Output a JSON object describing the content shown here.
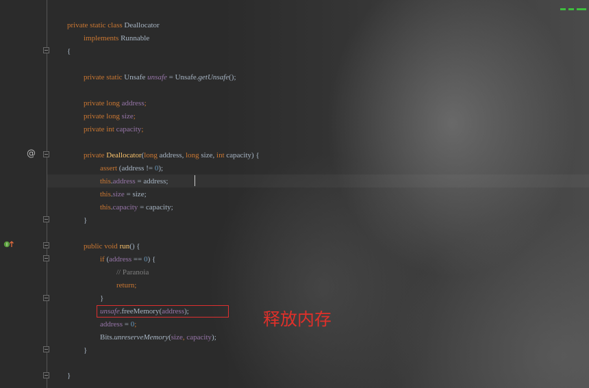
{
  "editor": {
    "lines": [
      {
        "id": "l1",
        "tokens": [
          {
            "t": "private static class ",
            "c": "kw"
          },
          {
            "t": "Deallocator",
            "c": "plain"
          }
        ]
      },
      {
        "id": "l2",
        "tokens": [
          {
            "t": "implements ",
            "c": "kw"
          },
          {
            "t": "Runnable",
            "c": "plain"
          }
        ]
      },
      {
        "id": "l3",
        "tokens": [
          {
            "t": "{",
            "c": "plain"
          }
        ]
      },
      {
        "id": "l4",
        "tokens": [
          {
            "t": "private static ",
            "c": "kw"
          },
          {
            "t": "Unsafe ",
            "c": "plain"
          },
          {
            "t": "unsafe",
            "c": "static-field"
          },
          {
            "t": " = Unsafe.",
            "c": "plain"
          },
          {
            "t": "getUnsafe",
            "c": "static-call"
          },
          {
            "t": "();",
            "c": "plain"
          }
        ]
      },
      {
        "id": "l5",
        "tokens": [
          {
            "t": "private long ",
            "c": "kw"
          },
          {
            "t": "address",
            "c": "field"
          },
          {
            "t": ";",
            "c": "kw"
          }
        ]
      },
      {
        "id": "l6",
        "tokens": [
          {
            "t": "private long ",
            "c": "kw"
          },
          {
            "t": "size",
            "c": "field"
          },
          {
            "t": ";",
            "c": "kw"
          }
        ]
      },
      {
        "id": "l7",
        "tokens": [
          {
            "t": "private int ",
            "c": "kw"
          },
          {
            "t": "capacity",
            "c": "field"
          },
          {
            "t": ";",
            "c": "kw"
          }
        ]
      },
      {
        "id": "l8",
        "tokens": [
          {
            "t": "private ",
            "c": "kw"
          },
          {
            "t": "Deallocator",
            "c": "method-decl"
          },
          {
            "t": "(",
            "c": "plain"
          },
          {
            "t": "long ",
            "c": "kw"
          },
          {
            "t": "address, ",
            "c": "plain"
          },
          {
            "t": "long ",
            "c": "kw"
          },
          {
            "t": "size, ",
            "c": "plain"
          },
          {
            "t": "int ",
            "c": "kw"
          },
          {
            "t": "capacity) {",
            "c": "plain"
          }
        ]
      },
      {
        "id": "l9",
        "tokens": [
          {
            "t": "assert ",
            "c": "kw"
          },
          {
            "t": "(address != ",
            "c": "plain"
          },
          {
            "t": "0",
            "c": "num"
          },
          {
            "t": ");",
            "c": "plain"
          }
        ]
      },
      {
        "id": "l10",
        "tokens": [
          {
            "t": "this",
            "c": "kw"
          },
          {
            "t": ".",
            "c": "plain"
          },
          {
            "t": "address",
            "c": "field"
          },
          {
            "t": " = address;",
            "c": "plain"
          }
        ]
      },
      {
        "id": "l11",
        "tokens": [
          {
            "t": "this",
            "c": "kw"
          },
          {
            "t": ".",
            "c": "plain"
          },
          {
            "t": "size",
            "c": "field"
          },
          {
            "t": " = size;",
            "c": "plain"
          }
        ]
      },
      {
        "id": "l12",
        "tokens": [
          {
            "t": "this",
            "c": "kw"
          },
          {
            "t": ".",
            "c": "plain"
          },
          {
            "t": "capacity",
            "c": "field"
          },
          {
            "t": " = capacity;",
            "c": "plain"
          }
        ]
      },
      {
        "id": "l13",
        "tokens": [
          {
            "t": "}",
            "c": "plain"
          }
        ]
      },
      {
        "id": "l14",
        "tokens": [
          {
            "t": "public void ",
            "c": "kw"
          },
          {
            "t": "run",
            "c": "method-decl"
          },
          {
            "t": "() {",
            "c": "plain"
          }
        ]
      },
      {
        "id": "l15",
        "tokens": [
          {
            "t": "if ",
            "c": "kw"
          },
          {
            "t": "(",
            "c": "plain"
          },
          {
            "t": "address",
            "c": "field"
          },
          {
            "t": " == ",
            "c": "plain"
          },
          {
            "t": "0",
            "c": "num"
          },
          {
            "t": ") {",
            "c": "plain"
          }
        ]
      },
      {
        "id": "l16",
        "tokens": [
          {
            "t": "// Paranoia",
            "c": "comment"
          }
        ]
      },
      {
        "id": "l17",
        "tokens": [
          {
            "t": "return",
            "c": "kw"
          },
          {
            "t": ";",
            "c": "kw"
          }
        ]
      },
      {
        "id": "l18",
        "tokens": [
          {
            "t": "}",
            "c": "plain"
          }
        ]
      },
      {
        "id": "l19",
        "tokens": [
          {
            "t": "unsafe",
            "c": "static-field"
          },
          {
            "t": ".freeMemory(",
            "c": "plain"
          },
          {
            "t": "address",
            "c": "field"
          },
          {
            "t": ");",
            "c": "plain"
          }
        ]
      },
      {
        "id": "l20",
        "tokens": [
          {
            "t": "address",
            "c": "field"
          },
          {
            "t": " = ",
            "c": "plain"
          },
          {
            "t": "0",
            "c": "num"
          },
          {
            "t": ";",
            "c": "kw"
          }
        ]
      },
      {
        "id": "l21",
        "tokens": [
          {
            "t": "Bits.",
            "c": "plain"
          },
          {
            "t": "unreserveMemory",
            "c": "static-call"
          },
          {
            "t": "(",
            "c": "plain"
          },
          {
            "t": "size",
            "c": "field"
          },
          {
            "t": ", ",
            "c": "kw"
          },
          {
            "t": "capacity",
            "c": "field"
          },
          {
            "t": ");",
            "c": "plain"
          }
        ]
      },
      {
        "id": "l22",
        "tokens": [
          {
            "t": "}",
            "c": "plain"
          }
        ]
      },
      {
        "id": "l23",
        "tokens": [
          {
            "t": "}",
            "c": "plain"
          }
        ]
      }
    ]
  },
  "gutter": {
    "override_icon": "at-icon",
    "override_symbol": "@",
    "implements_icon": "implements-method-icon"
  },
  "annotation": {
    "text": "释放内存",
    "color": "#e0302a"
  },
  "colors": {
    "keyword": "#cc7832",
    "field": "#9876aa",
    "method_declaration": "#ffc66d",
    "number": "#6897bb",
    "comment": "#808080",
    "text": "#a9b7c6",
    "highlight_box": "#e03030"
  }
}
